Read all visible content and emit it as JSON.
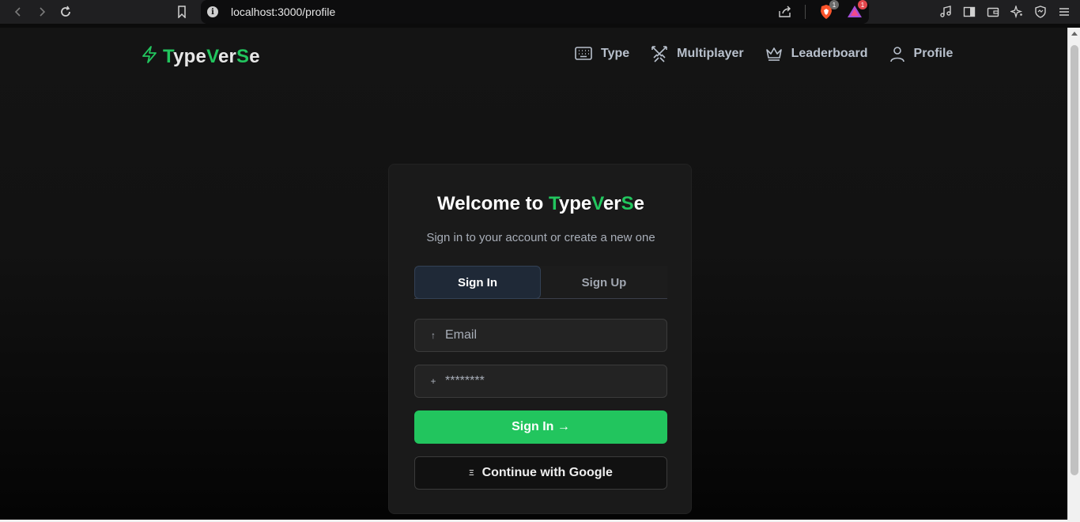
{
  "browser": {
    "url": "localhost:3000/profile",
    "brave_badge_count": "1",
    "rewards_badge_count": "1",
    "icons": [
      "back-arrow-icon",
      "forward-arrow-icon",
      "reload-icon",
      "bookmark-icon",
      "info-icon",
      "share-icon",
      "brave-shields-icon",
      "brave-rewards-icon",
      "music-icon",
      "sidebar-icon",
      "wallet-icon",
      "leo-ai-icon",
      "vpn-icon",
      "menu-icon"
    ]
  },
  "header": {
    "brand_parts": [
      "T",
      "ype",
      "V",
      "er",
      "S",
      "e"
    ],
    "nav": [
      {
        "label": "Type",
        "icon": "keyboard-icon"
      },
      {
        "label": "Multiplayer",
        "icon": "swords-icon"
      },
      {
        "label": "Leaderboard",
        "icon": "crown-icon"
      },
      {
        "label": "Profile",
        "icon": "user-icon"
      }
    ]
  },
  "auth": {
    "title_prefix": "Welcome to ",
    "title_brand_parts": [
      "T",
      "ype",
      "V",
      "er",
      "S",
      "e"
    ],
    "subtitle": "Sign in to your account or create a new one",
    "tabs": [
      {
        "label": "Sign In",
        "active": true
      },
      {
        "label": "Sign Up",
        "active": false
      }
    ],
    "email": {
      "placeholder": "Email",
      "icon_glyph": "↑",
      "icon": "arrow-up-icon"
    },
    "password": {
      "placeholder": "********",
      "icon_glyph": "+",
      "icon": "plus-icon"
    },
    "submit_label": "Sign In →",
    "google_label": "Continue with Google",
    "google_icon_glyph": "Ξ",
    "google_icon": "google-icon"
  },
  "colors": {
    "accent": "#22c55e",
    "background": "#121212",
    "card": "#1a1a1a",
    "active_tab": "#1f2937"
  }
}
